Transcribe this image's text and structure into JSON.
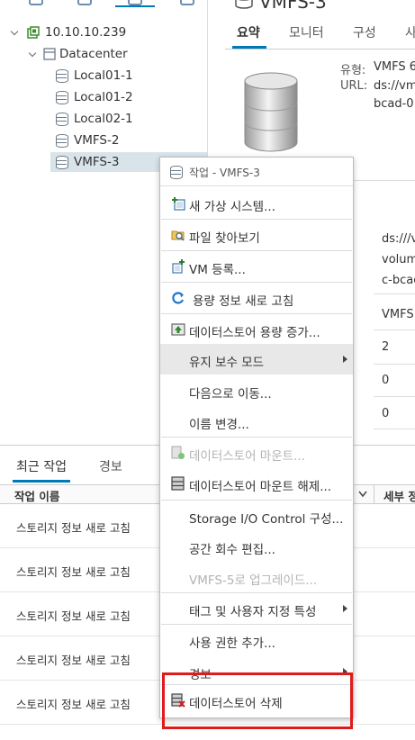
{
  "tree": {
    "host": "10.10.10.239",
    "datacenter": "Datacenter",
    "datastores": [
      "Local01-1",
      "Local01-2",
      "Local02-1",
      "VMFS-2",
      "VMFS-3"
    ]
  },
  "summary": {
    "title_fragment": "VMFS-3",
    "tabs": [
      "요약",
      "모니터",
      "구성",
      "사"
    ],
    "type_label": "유형:",
    "type_value": "VMFS 6",
    "url_label": "URL:",
    "url_value": "ds://vm",
    "url_value2": "bcad-0",
    "panel_values": [
      "ds:///v",
      "volum",
      "c-bcad",
      "VMFS",
      "2",
      "0",
      "0"
    ]
  },
  "bottom": {
    "tabs": [
      "최근 작업",
      "경보"
    ],
    "col_task_name": "작업 이름",
    "col_detail": "세부 정",
    "tasks": [
      "스토리지 정보 새로 고침",
      "스토리지 정보 새로 고침",
      "스토리지 정보 새로 고침",
      "스토리지 정보 새로 고침",
      "스토리지 정보 새로 고침"
    ]
  },
  "menu": {
    "header": "작업 - VMFS-3",
    "items": {
      "new_vm": "새 가상 시스템...",
      "browse_files": "파일 찾아보기",
      "register_vm": "VM 등록...",
      "refresh_capacity": "용량 정보 새로 고침",
      "increase_capacity": "데이터스토어 용량 증가...",
      "maintenance_mode": "유지 보수 모드",
      "move_to": "다음으로 이동...",
      "rename": "이름 변경...",
      "mount": "데이터스토어 마운트...",
      "unmount": "데이터스토어 마운트 해제...",
      "sioc": "Storage I/O Control 구성...",
      "space_reclaim": "공간 회수 편집...",
      "upgrade_vmfs5": "VMFS-5로 업그레이드...",
      "tags_attributes": "태그 및 사용자 지정 특성",
      "add_permission": "사용 권한 추가...",
      "alarms": "경보",
      "delete_datastore": "데이터스토어 삭제"
    }
  },
  "colors": {
    "accent": "#0079b8",
    "highlight": "#e01b1b",
    "host_green": "#3c8c2c"
  }
}
